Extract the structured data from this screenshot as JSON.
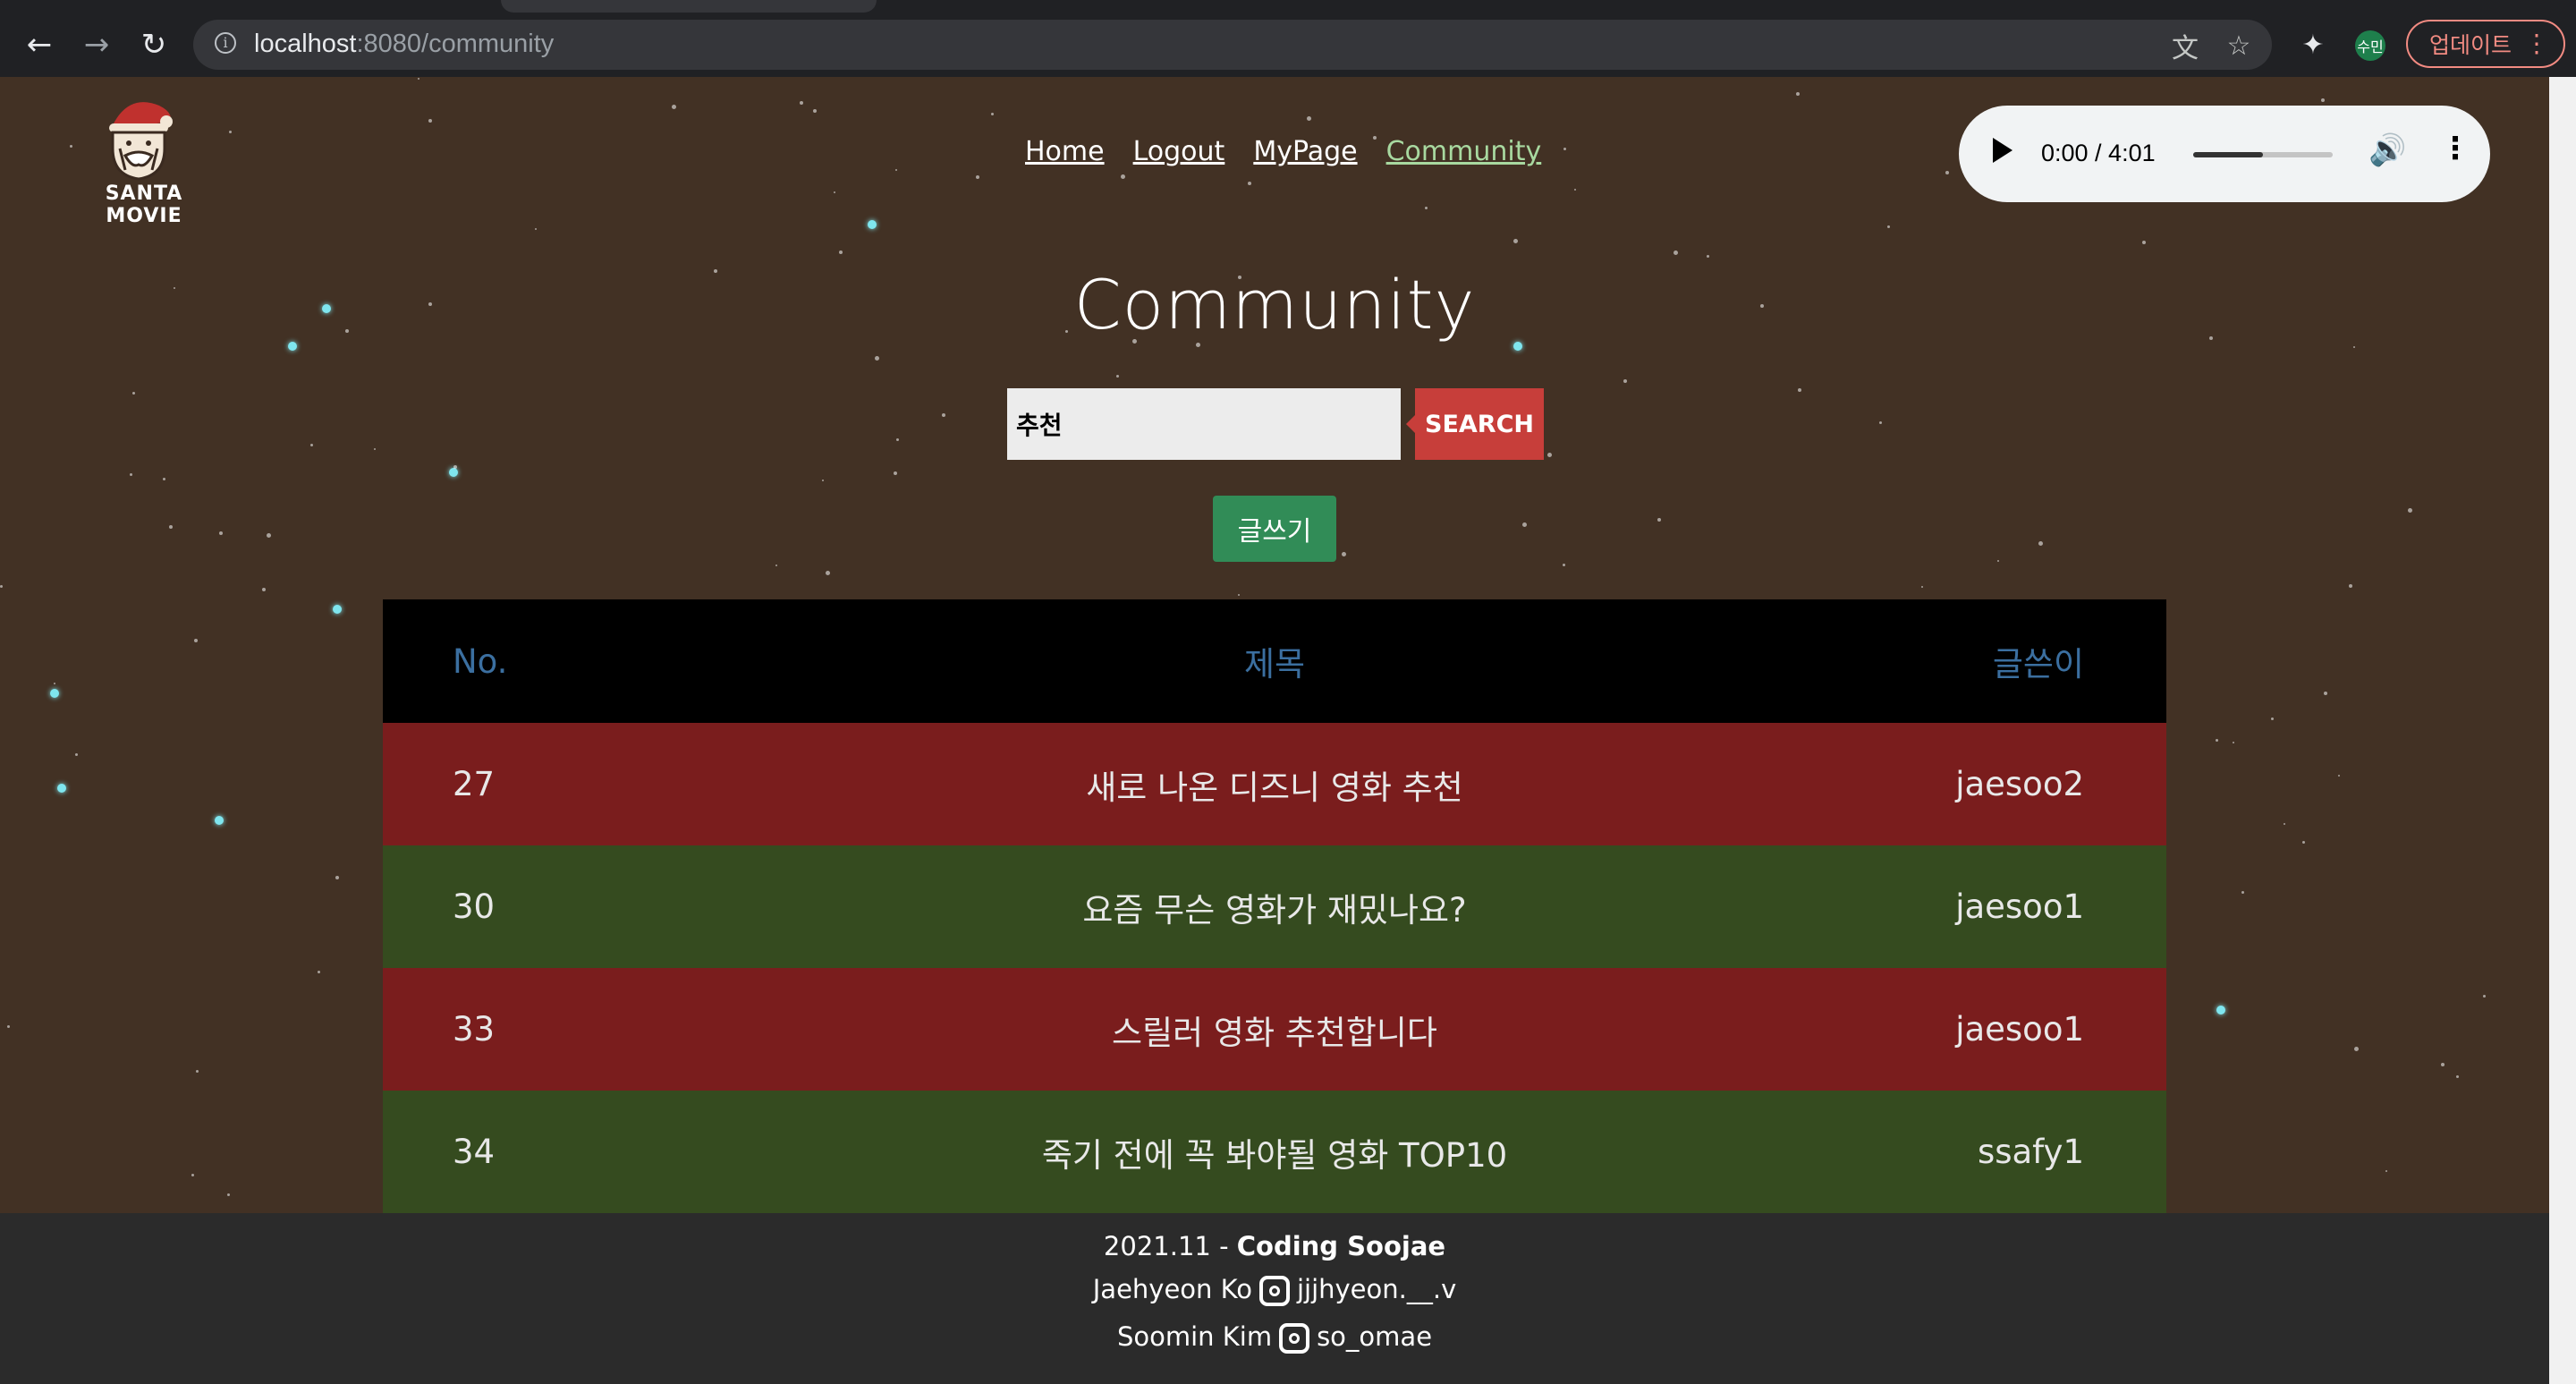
{
  "browser": {
    "url_host": "localhost",
    "url_path": ":8080/community",
    "update_label": "업데이트",
    "profile_label": "수민"
  },
  "site": {
    "logo_text": "SANTA MOVIE",
    "nav": [
      {
        "label": "Home"
      },
      {
        "label": "Logout"
      },
      {
        "label": "MyPage"
      },
      {
        "label": "Community",
        "active": true
      }
    ],
    "audio": {
      "time": "0:00 / 4:01",
      "volume_level": 0.5
    }
  },
  "main": {
    "title": "Community",
    "search_value": "추천",
    "search_button": "SEARCH",
    "write_button": "글쓰기"
  },
  "table": {
    "headers": {
      "no": "No.",
      "title": "제목",
      "writer": "글쓴이"
    },
    "rows": [
      {
        "no": "27",
        "title": "새로 나온 디즈니 영화 추천",
        "writer": "jaesoo2"
      },
      {
        "no": "30",
        "title": "요즘 무슨 영화가 재밌나요?",
        "writer": "jaesoo1"
      },
      {
        "no": "33",
        "title": "스릴러 영화 추천합니다",
        "writer": "jaesoo1"
      },
      {
        "no": "34",
        "title": "죽기 전에 꼭 봐야될 영화 TOP10",
        "writer": "ssafy1"
      }
    ]
  },
  "footer": {
    "date": "2021.11 - ",
    "team": "Coding Soojae",
    "member1_name": "Jaehyeon Ko",
    "member1_ig": "jjjhyeon.__.v",
    "member2_name": "Soomin Kim",
    "member2_ig": "so_omae"
  },
  "colors": {
    "background": "#423124",
    "row_red": "#7a1d1d",
    "row_green": "#354b1f",
    "search_button": "#c73e3a",
    "write_button": "#318c57",
    "active_nav": "#a8d9a0"
  }
}
